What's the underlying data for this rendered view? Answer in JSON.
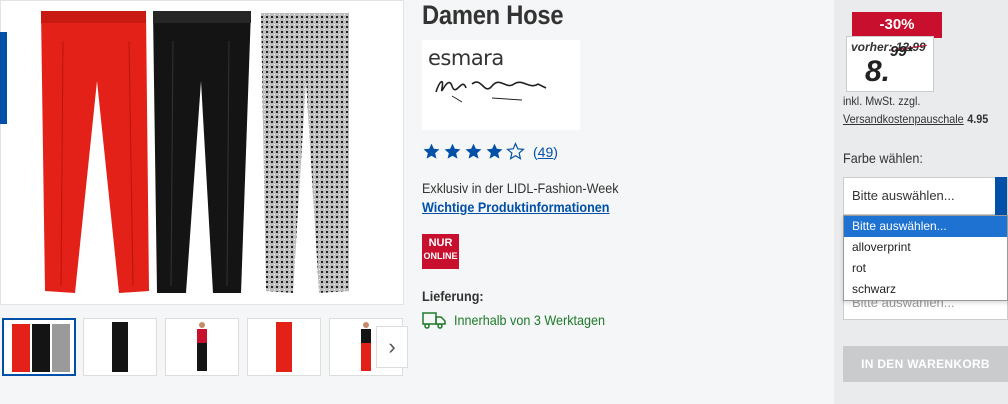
{
  "product": {
    "title": "Damen Hose",
    "brand_logo_text": "esmara",
    "brand_signature": "Heidi Klum",
    "rating": {
      "stars": 4,
      "max": 5,
      "count": "49"
    },
    "exclusive_text": "Exklusiv in der LIDL-Fashion-Week",
    "info_link": "Wichtige Produktinformationen",
    "badge": {
      "line1": "NUR",
      "line2": "ONLINE"
    },
    "delivery": {
      "label": "Lieferung:",
      "text": "Innerhalb von 3 Werktagen"
    }
  },
  "gallery": {
    "thumbnails": [
      "thumb-1",
      "thumb-2",
      "thumb-3",
      "thumb-4",
      "thumb-5"
    ],
    "next_icon": "›",
    "colors": [
      "#e32119",
      "#141414",
      "#8a8a8a"
    ]
  },
  "price": {
    "discount": "-30%",
    "before_label": "vorher:",
    "before_value": "12.99",
    "main": "8.",
    "cents": "99*",
    "vat_text": "inkl. MwSt. zzgl.",
    "shipping_label": "Versandkostenpauschale",
    "shipping_value": "4.95"
  },
  "options": {
    "color_label": "Farbe wählen:",
    "select_value": "Bitte auswählen...",
    "dropdown_items": [
      "Bitte auswählen...",
      "alloverprint",
      "rot",
      "schwarz"
    ],
    "select2_value": "Bitte auswählen..."
  },
  "cart": {
    "button_label": "IN DEN WARENKORB"
  },
  "colors": {
    "accent": "#0050aa",
    "red": "#c8102e",
    "green": "#1f7a2b"
  }
}
